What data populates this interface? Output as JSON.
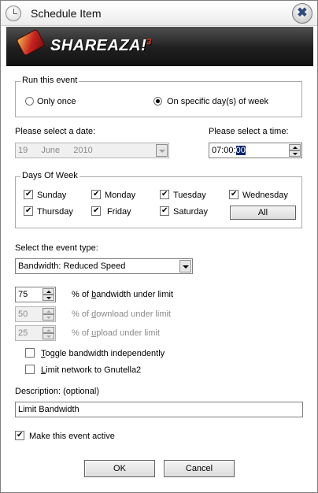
{
  "window": {
    "title": "Schedule Item",
    "close_label": "✖"
  },
  "brand": {
    "name": "SHAREAZA!",
    "version_mark": "3"
  },
  "run_event": {
    "title": "Run this event",
    "only_once": "Only once",
    "specific_days": "On specific day(s) of week",
    "selected": "specific_days"
  },
  "date": {
    "label": "Please select a date:",
    "day": "19",
    "month": "June",
    "year": "2010"
  },
  "time": {
    "label": "Please select a time:",
    "prefix": "07:00:",
    "selected": "00"
  },
  "days": {
    "title": "Days Of Week",
    "items": [
      {
        "label": "Sunday",
        "checked": true
      },
      {
        "label": "Monday",
        "checked": true
      },
      {
        "label": "Tuesday",
        "checked": true
      },
      {
        "label": "Wednesday",
        "checked": true
      },
      {
        "label": "Thursday",
        "checked": true
      },
      {
        "label": "Friday",
        "checked": true
      },
      {
        "label": "Saturday",
        "checked": true
      }
    ],
    "all_button": "All"
  },
  "event_type": {
    "label": "Select the event type:",
    "value": "Bandwidth: Reduced Speed"
  },
  "bandwidth": {
    "total_value": "75",
    "total_label_pre": "% of ",
    "total_label_u": "b",
    "total_label_post": "andwidth under limit",
    "download_value": "50",
    "download_label_pre": "% of ",
    "download_label_u": "d",
    "download_label_post": "ownload under limit",
    "upload_value": "25",
    "upload_label_pre": "% of ",
    "upload_label_u": "u",
    "upload_label_post": "pload under limit"
  },
  "options": {
    "toggle_u": "T",
    "toggle_rest": "oggle bandwidth independently",
    "limit_u": "L",
    "limit_rest": "imit network to Gnutella2"
  },
  "description": {
    "label": "Description: (optional)",
    "value": "Limit Bandwidth"
  },
  "active": {
    "label": "Make this event active",
    "checked": true
  },
  "buttons": {
    "ok": "OK",
    "cancel": "Cancel"
  }
}
